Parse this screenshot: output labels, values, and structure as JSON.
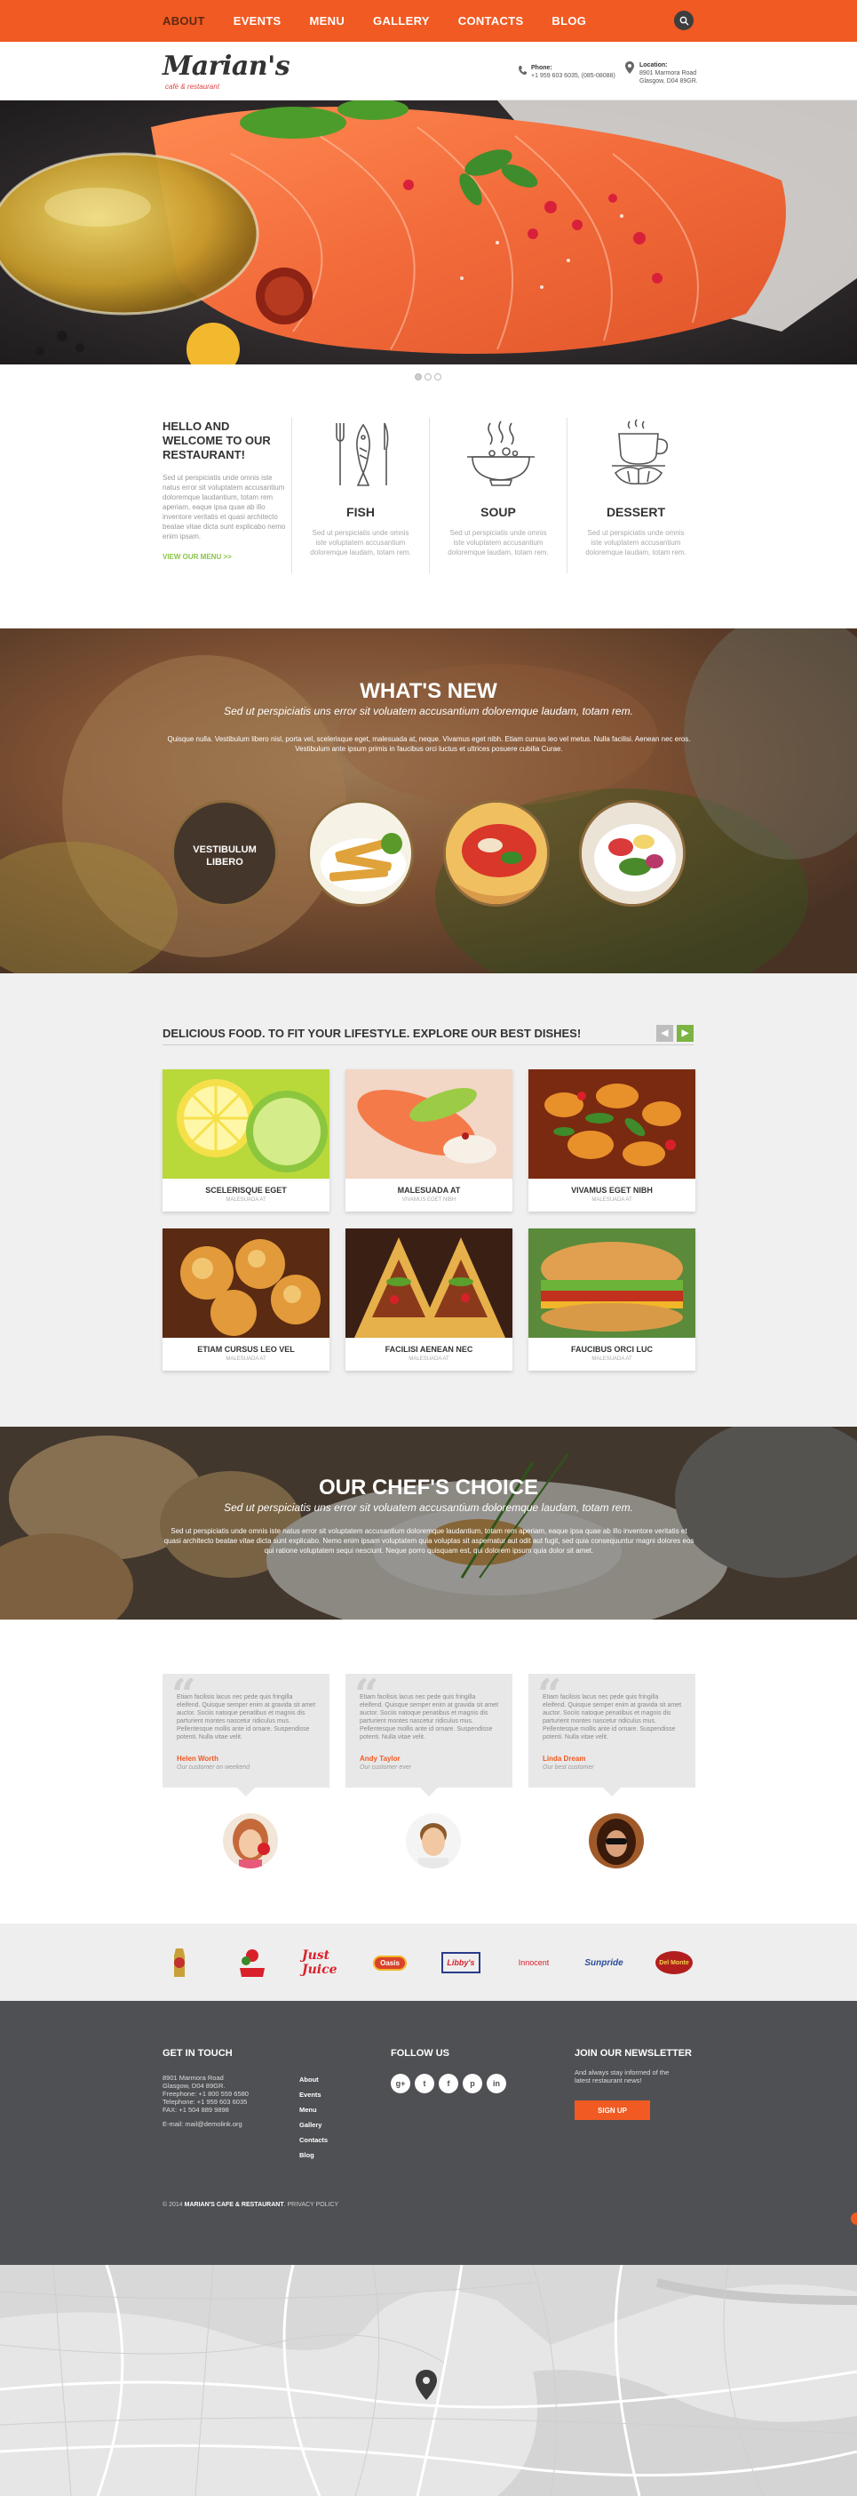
{
  "nav": {
    "items": [
      "ABOUT",
      "EVENTS",
      "MENU",
      "GALLERY",
      "CONTACTS",
      "BLOG"
    ],
    "active": "ABOUT"
  },
  "header": {
    "logo": "Marian's",
    "logo_sub": "café & restaurant",
    "phone_label": "Phone:",
    "phone_value": "+1 959 603 6035, (085-08088)",
    "location_label": "Location:",
    "location_line1": "8901 Marmora Road",
    "location_line2": "Glasgow, D04 89GR."
  },
  "welcome": {
    "title": "Hello and welcome to our restaurant!",
    "text": "Sed ut perspiciatis unde omnis iste natus error sit voluptatem accusantium doloremque laudantium, totam rem aperiam, eaque ipsa quae ab illo inventore veritatis et quasi architecto beatae vitae dicta sunt explicabo nemo enim ipsam.",
    "link": "VIEW OUR MENU >>",
    "columns": [
      {
        "title": "FISH",
        "icon": "fish-icon",
        "text": "Sed ut perspiciatis unde omnis iste voluptatem accusantium doloremque laudam, totam rem."
      },
      {
        "title": "SOUP",
        "icon": "soup-icon",
        "text": "Sed ut perspiciatis unde omnis iste voluptatem accusantium doloremque laudam, totam rem."
      },
      {
        "title": "DESSERT",
        "icon": "dessert-icon",
        "text": "Sed ut perspiciatis unde omnis iste voluptatem accusantium doloremque laudam, totam rem."
      }
    ]
  },
  "whats_new": {
    "title": "WHAT'S NEW",
    "subtitle": "Sed ut perspiciatis uns error sit voluatem accusantium doloremque laudam, totam rem.",
    "text": "Quisque nulla. Vestibulum libero nisl, porta vel, scelerisque eget, malesuada at, neque. Vivamus eget nibh. Etiam cursus leo vel metus. Nulla facilisi. Aenean nec eros. Vestibulum ante ipsum primis in faucibus orci luctus et ultrices posuere cubilia Curae.",
    "circle_label": "VESTIBULUM LIBERO"
  },
  "dishes": {
    "title": "DELICIOUS FOOD. TO FIT YOUR LIFESTYLE. EXPLORE OUR BEST DISHES!",
    "items": [
      {
        "name": "SCELERISQUE EGET",
        "category": "MALESUADA AT"
      },
      {
        "name": "MALESUADA AT",
        "category": "VIVAMUS EGET NIBH"
      },
      {
        "name": "VIVAMUS EGET NIBH",
        "category": "MALESUADA AT"
      },
      {
        "name": "ETIAM CURSUS LEO VEL",
        "category": "MALESUADA AT"
      },
      {
        "name": "FACILISI AENEAN NEC",
        "category": "MALESUADA AT"
      },
      {
        "name": "FAUCIBUS ORCI LUC",
        "category": "MALESUADA AT"
      }
    ]
  },
  "chef": {
    "title": "OUR CHEF'S CHOICE",
    "subtitle": "Sed ut perspiciatis uns error sit voluatem accusantium doloremque laudam, totam rem.",
    "text": "Sed ut perspiciatis unde omnis iste natus error sit voluptatem accusantium doloremque laudantium, totam rem aperiam, eaque ipsa quae ab illo inventore veritatis et quasi architecto beatae vitae dicta sunt explicabo. Nemo enim ipsam voluptatem quia voluptas sit aspernatur aut odit aut fugit, sed quia consequuntur magni dolores eos qui ratione voluptatem sequi nesciunt. Neque porro quisquam est, qui dolorem ipsum quia dolor sit amet."
  },
  "testimonials": [
    {
      "text": "Etiam facilisis lacus nec pede quis fringilla eleifend. Quisque semper enim at gravida sit amet auctor. Sociis natoque penatibus et magnis dis parturient montes nascetur ridiculus mus. Pellentesque mollis ante id ornare. Suspendisse potenti. Nulla vitae velit.",
      "name": "Helen Worth",
      "role": "Our customer on weekend"
    },
    {
      "text": "Etiam facilisis lacus nec pede quis fringilla eleifend. Quisque semper enim at gravida sit amet auctor. Sociis natoque penatibus et magnis dis parturient montes nascetur ridiculus mus. Pellentesque mollis ante id ornare. Suspendisse potenti. Nulla vitae velit.",
      "name": "Andy Taylor",
      "role": "Our customer ever"
    },
    {
      "text": "Etiam facilisis lacus nec pede quis fringilla eleifend. Quisque semper enim at gravida sit amet auctor. Sociis natoque penatibus et magnis dis parturient montes nascetur ridiculus mus. Pellentesque mollis ante id ornare. Suspendisse potenti. Nulla vitae velit.",
      "name": "Linda Dream",
      "role": "Our best customer"
    }
  ],
  "brands": [
    "Innocent",
    "Sunpride",
    "Del Monte",
    "Libby's",
    "Just Juice",
    "Oasis",
    "Chiquita",
    "Ocean Spray"
  ],
  "footer": {
    "get_in_touch": {
      "title": "GET IN TOUCH",
      "address1": "8901 Marmora Road",
      "address2": "Glasgow, D04 89GR.",
      "freephone": "Freephone:   +1 800 559 6580",
      "telephone": "Telephone:   +1 959 603 6035",
      "fax": "FAX:            +1 504 889 9898",
      "email": "E-mail: mail@demolink.org"
    },
    "links": [
      "About",
      "Events",
      "Menu",
      "Gallery",
      "Contacts",
      "Blog"
    ],
    "follow_us": {
      "title": "FOLLOW US",
      "icons": [
        "google-plus-icon",
        "twitter-icon",
        "facebook-icon",
        "pinterest-icon",
        "linkedin-icon"
      ],
      "glyphs": [
        "g+",
        "t",
        "f",
        "p",
        "in"
      ]
    },
    "newsletter": {
      "title": "JOIN OUR NEWSLETTER",
      "text": "And always stay informed of the latest restaurant news!",
      "button": "SIGN UP"
    },
    "copyright_year": "© 2014",
    "copyright_name": "MARIAN'S CAFE & RESTAURANT",
    "privacy": ". PRIVACY POLICY"
  },
  "colors": {
    "accent": "#f15a22",
    "green": "#8bc34a",
    "footer": "#4f5054"
  }
}
